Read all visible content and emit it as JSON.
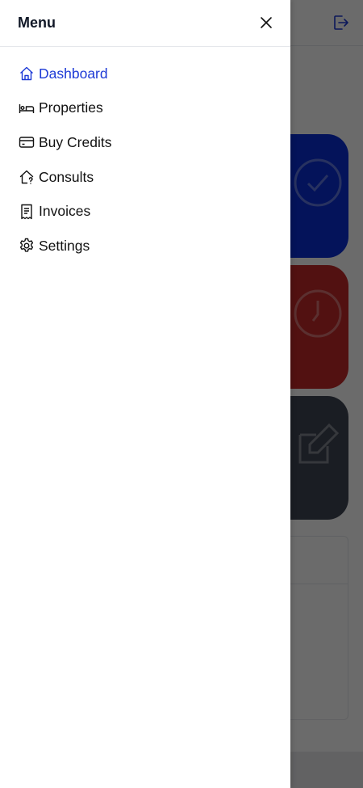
{
  "drawer": {
    "title": "Menu",
    "close_icon": "close-icon",
    "items": [
      {
        "label": "Dashboard",
        "icon": "home-icon",
        "active": true
      },
      {
        "label": "Properties",
        "icon": "bed-icon",
        "active": false
      },
      {
        "label": "Buy Credits",
        "icon": "credit-card-icon",
        "active": false
      },
      {
        "label": "Consults",
        "icon": "home-question-icon",
        "active": false
      },
      {
        "label": "Invoices",
        "icon": "receipt-icon",
        "active": false
      },
      {
        "label": "Settings",
        "icon": "gear-icon",
        "active": false
      }
    ]
  },
  "background": {
    "logout_icon": "logout-icon",
    "cards": [
      {
        "color": "#0a2fd6",
        "icon": "check-circle-icon"
      },
      {
        "color": "#c42a2a",
        "icon": "clock-icon"
      },
      {
        "color": "#3f4553",
        "icon": "edit-icon"
      }
    ]
  },
  "colors": {
    "accent": "#1d3ad6",
    "overlay": "rgba(0,0,0,0.58)"
  }
}
